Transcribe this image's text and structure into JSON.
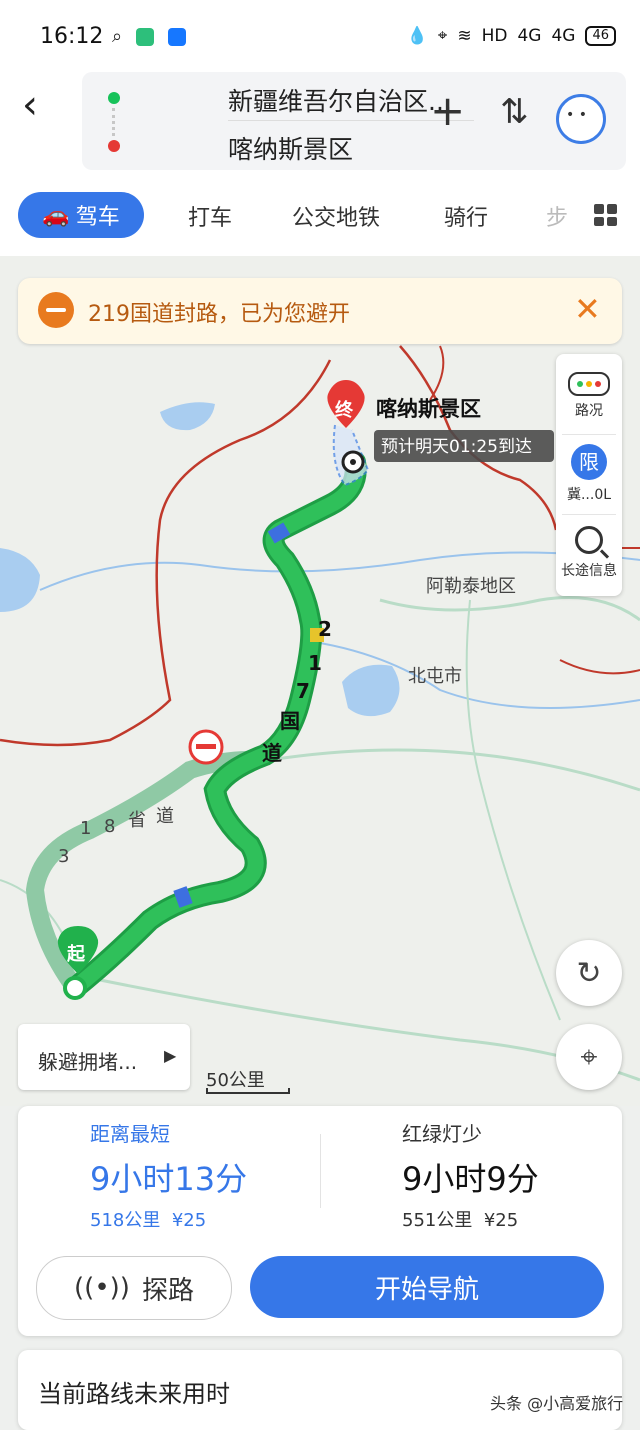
{
  "status_bar": {
    "time": "16:12",
    "network": "HD",
    "signal1": "4G",
    "signal2": "4G",
    "battery": "46"
  },
  "header": {
    "from": "新疆维吾尔自治区...",
    "to": "喀纳斯景区"
  },
  "tabs": [
    {
      "label": "驾车"
    },
    {
      "label": "打车"
    },
    {
      "label": "公交地铁"
    },
    {
      "label": "骑行"
    },
    {
      "label": "步"
    }
  ],
  "notice": {
    "text": "219国道封路，已为您避开"
  },
  "map": {
    "destination_marker": "终",
    "destination_label": "喀纳斯景区",
    "eta_label": "预计明天01:25到达",
    "start_marker": "起",
    "place_labels": [
      "阿勒泰地区",
      "北屯市"
    ],
    "road_main": [
      "2",
      "1",
      "7",
      "国",
      "道"
    ],
    "road_alt": [
      "3",
      "1",
      "8",
      "省",
      "道"
    ]
  },
  "side_panel": {
    "traffic": "路况",
    "limit_icon": "限",
    "limit": "冀...0L",
    "info": "长途信息"
  },
  "avoid_button": "躲避拥堵...",
  "scale": "50公里",
  "routes": [
    {
      "label": "距离最短",
      "time": "9小时13分",
      "distance": "518公里",
      "toll": "¥25"
    },
    {
      "label": "红绿灯少",
      "time": "9小时9分",
      "distance": "551公里",
      "toll": "¥25"
    }
  ],
  "actions": {
    "probe": "探路",
    "start": "开始导航"
  },
  "future": {
    "title": "当前路线未来用时"
  },
  "watermark": "头条 @小高爱旅行",
  "colors": {
    "primary": "#3677e8",
    "route": "#21b14c",
    "alt_route": "#8fc9a5",
    "boundary": "#c0392b",
    "notice": "#e87a1f"
  }
}
